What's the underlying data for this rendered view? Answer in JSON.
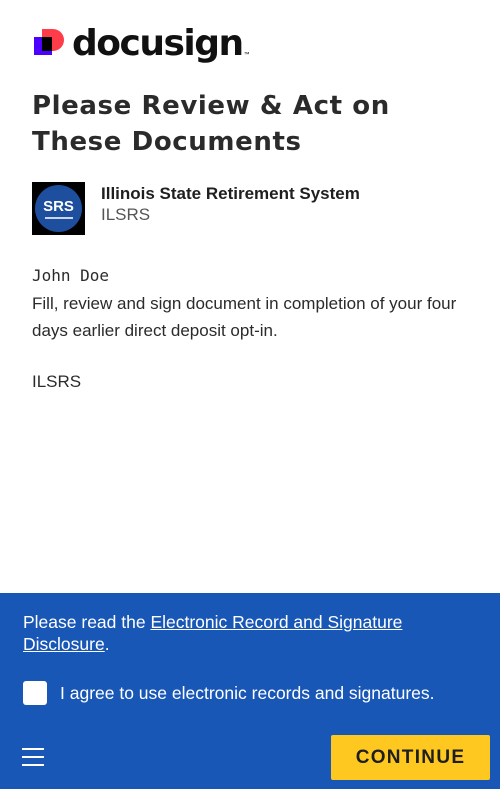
{
  "brand": {
    "name": "docusign",
    "tm": "™"
  },
  "page": {
    "title": "Please Review & Act on These Documents"
  },
  "sender": {
    "name": "Illinois State Retirement System",
    "short_name": "ILSRS",
    "avatar_text": "SRS",
    "avatar_icon": "ilsrs-logo-icon"
  },
  "message": {
    "recipient": "John Doe",
    "body": "Fill, review and sign document in completion of your four days earlier direct deposit opt-in.",
    "signoff": "ILSRS"
  },
  "footer": {
    "disclosure_prefix": "Please read the ",
    "disclosure_link": "Electronic Record and Signature Disclosure",
    "disclosure_suffix": ".",
    "agree_label": "I agree to use electronic records and signatures.",
    "agree_checked": false,
    "continue_label": "CONTINUE",
    "menu_icon": "hamburger-menu-icon",
    "colors": {
      "panel": "#1857b5",
      "button": "#ffc820"
    }
  }
}
